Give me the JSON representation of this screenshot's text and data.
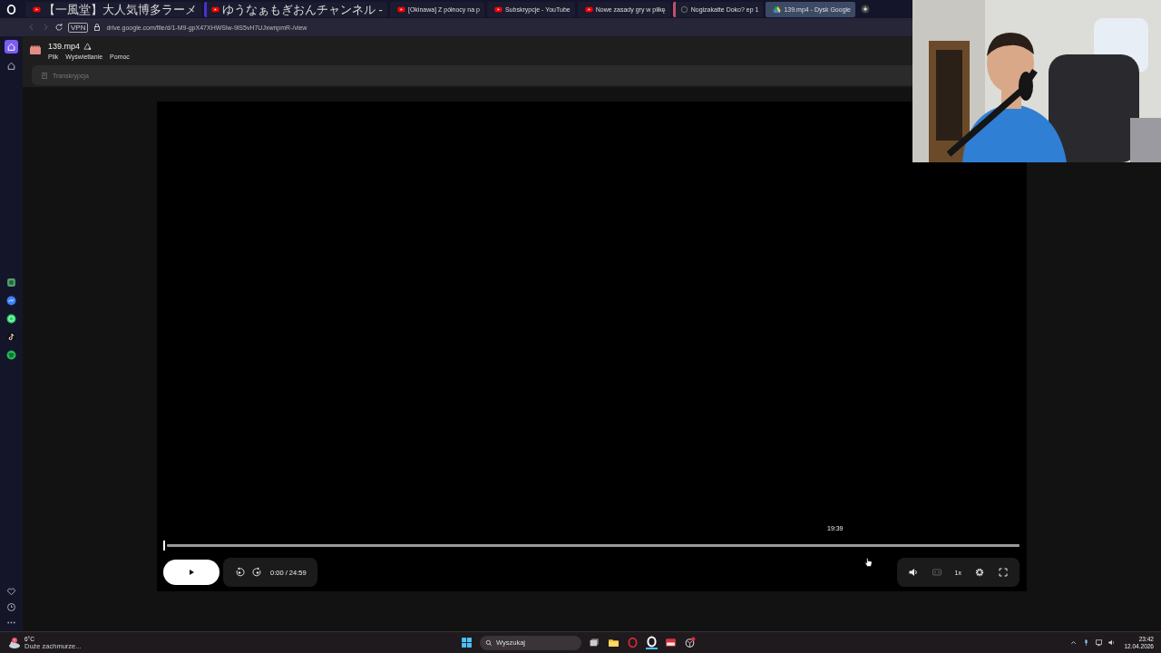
{
  "browser": {
    "tabs": [
      {
        "label": "【一風堂】大人気博多ラーメ",
        "kind": "youtube",
        "selected": false
      },
      {
        "label": "ゆうなぁもぎおんチャンネル - ",
        "kind": "youtube",
        "color": "#4b2fd0",
        "selected": false
      },
      {
        "label": "[Okinawa] Z północy na p",
        "kind": "youtube",
        "selected": false
      },
      {
        "label": "Subskrypcje - YouTube",
        "kind": "youtube",
        "selected": false
      },
      {
        "label": "Nowe zasady gry w piłkę",
        "kind": "youtube",
        "selected": false
      },
      {
        "label": "Nogizakatte Doko? ep 1",
        "kind": "site",
        "color": "#c0506a",
        "selected": false
      },
      {
        "label": "139.mp4 - Dysk Google",
        "kind": "drive",
        "selected": true
      }
    ],
    "vpn_badge": "VPN",
    "address": "drive.google.com/file/d/1-M9-gpX47XHWSlw-9lS5vH7UJxwnpmR-/view"
  },
  "sidebar": {
    "items": [
      {
        "kind": "home",
        "selected": true
      },
      {
        "kind": "star",
        "selected": false
      }
    ]
  },
  "file": {
    "name": "139.mp4",
    "menu": [
      "Plik",
      "Wyświetlanie",
      "Pomoc"
    ],
    "transcript_label": "Transkrypcja"
  },
  "player": {
    "progress": {
      "level": 0,
      "hover_time": "19:39"
    },
    "time": "0:00 / 24:59",
    "speed": "1x",
    "captions_disabled": true
  },
  "taskbar": {
    "weather": {
      "temp": "6°C",
      "desc": "Duże zachmurze..."
    },
    "search_placeholder": "Wyszukaj",
    "time": "23:42",
    "date": "12.04.2026"
  }
}
